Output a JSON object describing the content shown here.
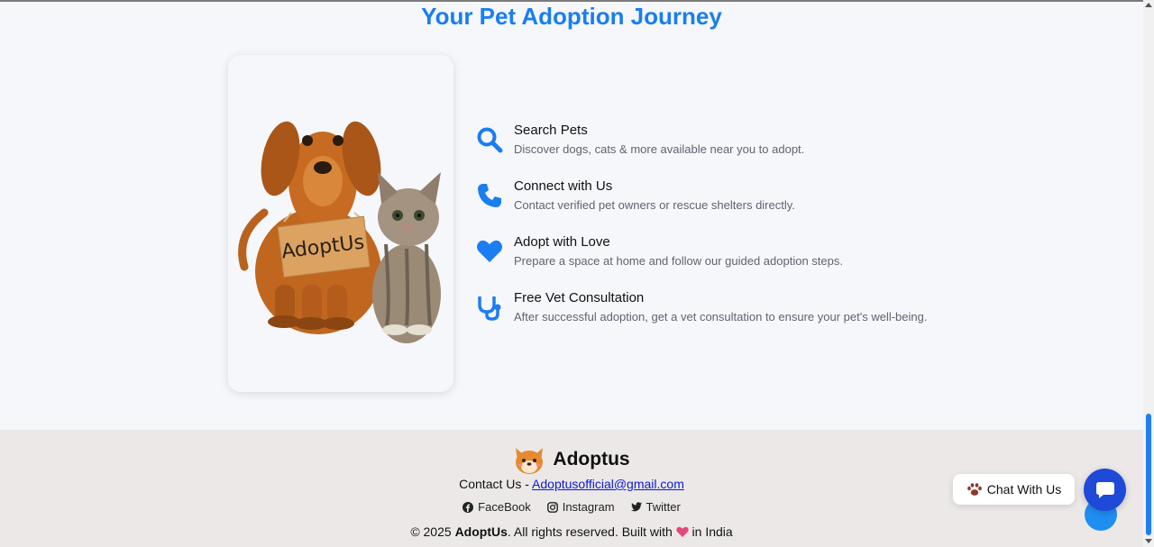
{
  "section": {
    "title": "Your Pet Adoption Journey",
    "card_sign": "AdoptUs",
    "steps": [
      {
        "icon": "search-icon",
        "title": "Search Pets",
        "desc": "Discover dogs, cats & more available near you to adopt."
      },
      {
        "icon": "phone-icon",
        "title": "Connect with Us",
        "desc": "Contact verified pet owners or rescue shelters directly."
      },
      {
        "icon": "heart-icon",
        "title": "Adopt with Love",
        "desc": "Prepare a space at home and follow our guided adoption steps."
      },
      {
        "icon": "stethoscope-icon",
        "title": "Free Vet Consultation",
        "desc": "After successful adoption, get a vet consultation to ensure your pet's well-being."
      }
    ],
    "accent_color": "#1a7ef0"
  },
  "footer": {
    "brand": "Adoptus",
    "contact_prefix": "Contact Us - ",
    "contact_email": "Adoptusofficial@gmail.com",
    "socials": [
      {
        "icon": "facebook-icon",
        "label": "FaceBook"
      },
      {
        "icon": "instagram-icon",
        "label": "Instagram"
      },
      {
        "icon": "twitter-icon",
        "label": "Twitter"
      }
    ],
    "copy_prefix": "© 2025 ",
    "copy_brand": "AdoptUs",
    "copy_mid": ". All rights reserved. Built with ",
    "copy_suffix": " in India"
  },
  "chat": {
    "label": "Chat With Us"
  }
}
